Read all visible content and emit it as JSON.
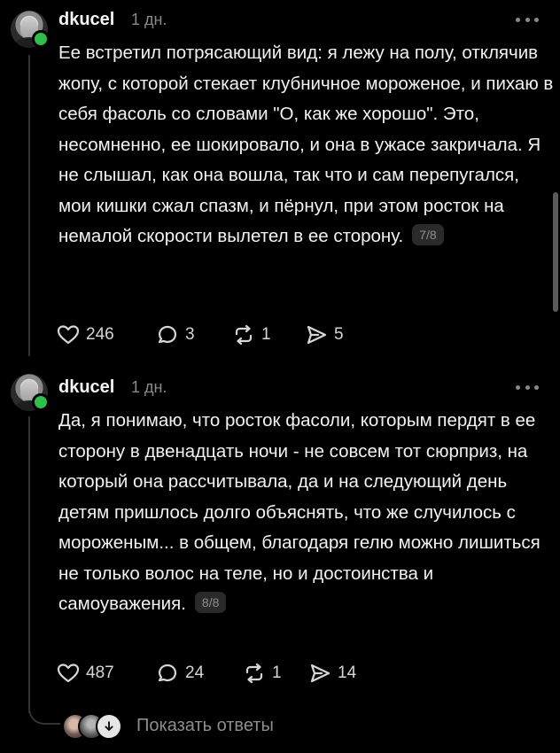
{
  "posts": [
    {
      "username": "dkucel",
      "time": "1 дн.",
      "text": "Ее встретил потрясающий вид: я лежу на полу, отклячив жопу, с которой стекает клубничное мороженое, и пихаю в себя фасоль со словами \"О, как же хорошо\". Это, несомненно, ее шокировало, и она в ужасе закричала. Я не слышал, как она вошла, так что и сам перепугался, мои кишки сжал спазм, и пёрнул, при этом росток на немалой скорости вылетел в ее сторону.",
      "page_badge": "7/8",
      "likes": "246",
      "comments": "3",
      "reposts": "1",
      "shares": "5"
    },
    {
      "username": "dkucel",
      "time": "1 дн.",
      "text": "Да, я понимаю, что росток фасоли, которым пердят в ее сторону в двенадцать ночи - не совсем тот сюрприз, на который она рассчитывала, да и на следующий день детям пришлось долго объяснять, что же случилось с мороженым... в общем, благодаря гелю можно лишиться не только волос на теле, но и достоинства и самоуважения.",
      "page_badge": "8/8",
      "likes": "487",
      "comments": "24",
      "reposts": "1",
      "shares": "14"
    }
  ],
  "replies": {
    "label": "Показать ответы"
  },
  "icons": {
    "like": "heart-icon",
    "comment": "comment-icon",
    "repost": "repost-icon",
    "share": "share-icon",
    "more": "more-icon",
    "show_replies": "arrow-down-icon"
  },
  "colors": {
    "background": "#000000",
    "text": "#f2f2f2",
    "muted": "#8a8a8a",
    "online": "#2fbf4a",
    "badge": "#2a2a2a"
  }
}
